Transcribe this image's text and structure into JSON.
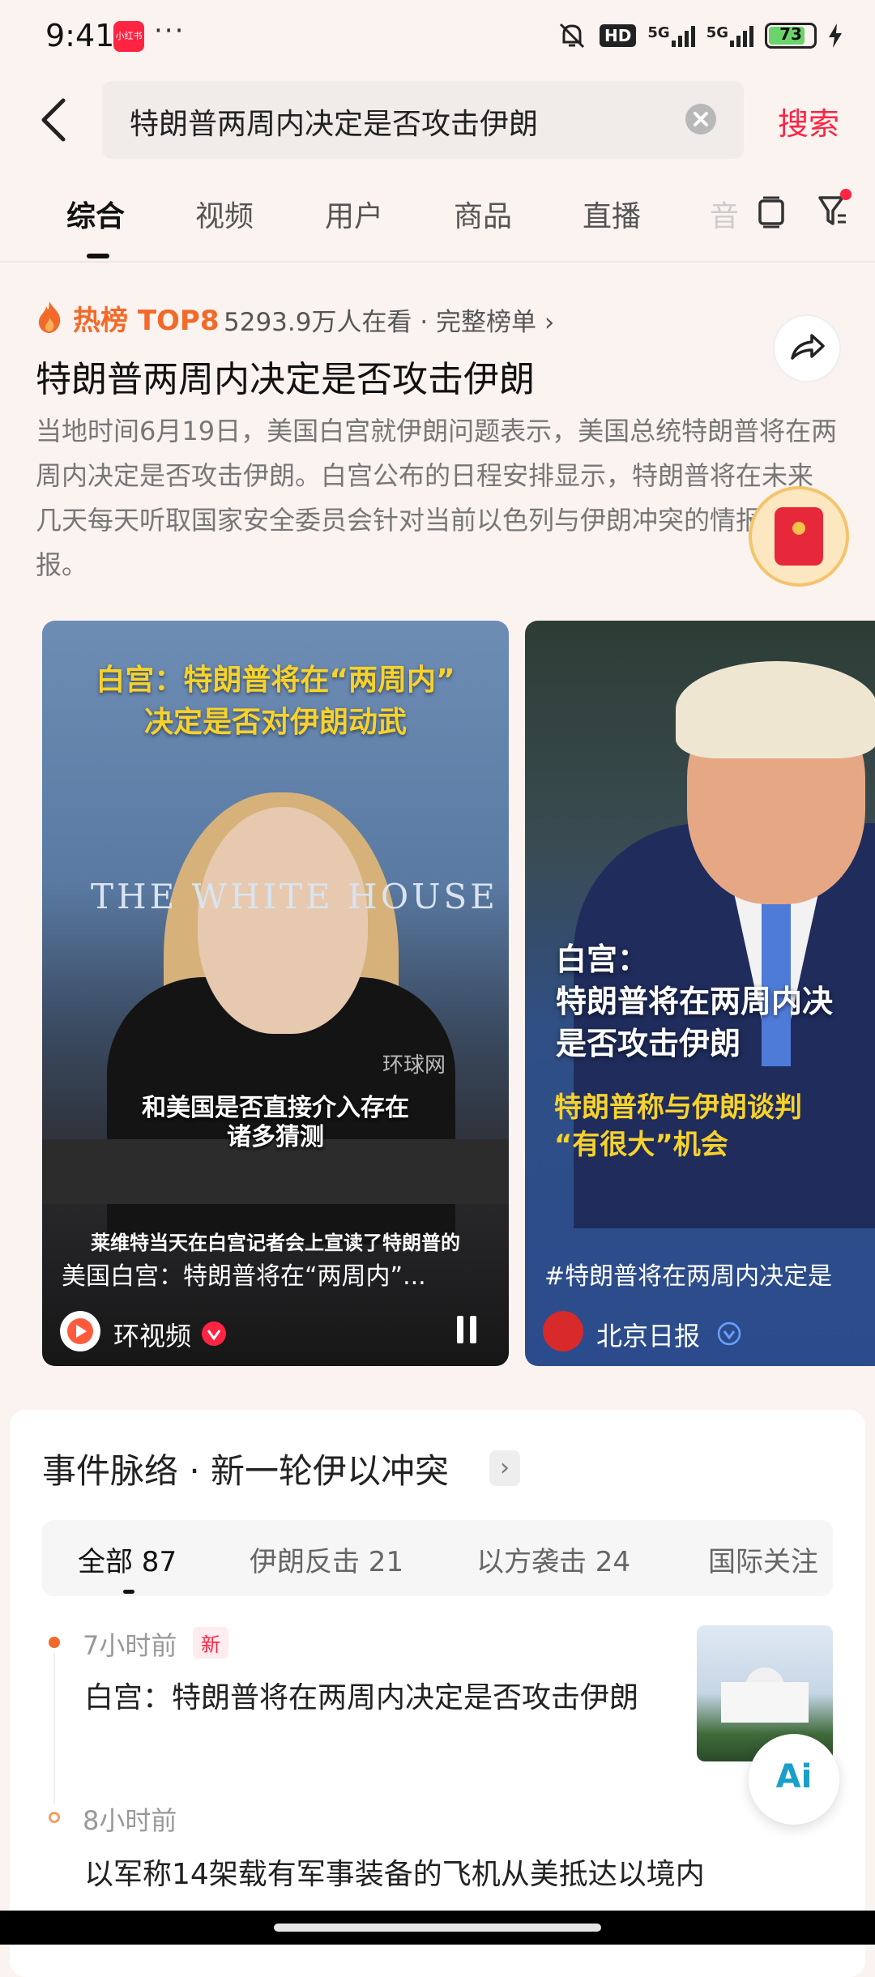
{
  "status_bar": {
    "time": "9:41",
    "app_icon_text": "小红书",
    "dots": "···",
    "hd_label": "HD",
    "net1": "5G",
    "net2": "5G",
    "battery": "73"
  },
  "search": {
    "query": "特朗普两周内决定是否攻击伊朗",
    "button_label": "搜索"
  },
  "tabs": [
    {
      "label": "综合"
    },
    {
      "label": "视频"
    },
    {
      "label": "用户"
    },
    {
      "label": "商品"
    },
    {
      "label": "直播"
    },
    {
      "label": "音"
    }
  ],
  "hot": {
    "label": "热榜 TOP8",
    "viewers": "5293.9万人在看 · 完整榜单 ›",
    "title": "特朗普两周内决定是否攻击伊朗",
    "description": "当地时间6月19日，美国白宫就伊朗问题表示，美国总统特朗普将在两周内决定是否攻击伊朗。白宫公布的日程安排显示，特朗普将在未来几天每天听取国家安全委员会针对当前以色列与伊朗冲突的情报简报。"
  },
  "cards": [
    {
      "headline_l1": "白宫：特朗普将在“两周内”",
      "headline_l2": "决定是否对伊朗动武",
      "backdrop": "THE WHITE HOUSE",
      "watermark": "环球网",
      "subtitle_l1": "和美国是否直接介入存在",
      "subtitle_l2": "诸多猜测",
      "small_caption": "莱维特当天在白宫记者会上宣读了特朗普的",
      "title": "美国白宫：特朗普将在“两周内”...",
      "author": "环视频"
    },
    {
      "headline_l1": "白宫：",
      "headline_l2": "特朗普将在两周内决",
      "headline_l3": "是否攻击伊朗",
      "sub_l1": "特朗普称与伊朗谈判",
      "sub_l2": "“有很大”机会",
      "title": "#特朗普将在两周内决定是",
      "author": "北京日报"
    }
  ],
  "timeline": {
    "title": "事件脉络 · 新一轮伊以冲突",
    "arrow": "›",
    "filters": [
      {
        "label": "全部 87"
      },
      {
        "label": "伊朗反击 21"
      },
      {
        "label": "以方袭击 24"
      },
      {
        "label": "国际关注"
      }
    ],
    "items": [
      {
        "time": "7小时前",
        "badge": "新",
        "text": "白宫：特朗普将在两周内决定是否攻击伊朗"
      },
      {
        "time": "8小时前",
        "text": "以军称14架载有军事装备的飞机从美抵达以境内"
      }
    ],
    "ai_label": "Ai"
  },
  "colors": {
    "brand_red": "#ff2442",
    "hot_orange": "#f26a2a",
    "caption_yellow": "#f7d22b"
  }
}
